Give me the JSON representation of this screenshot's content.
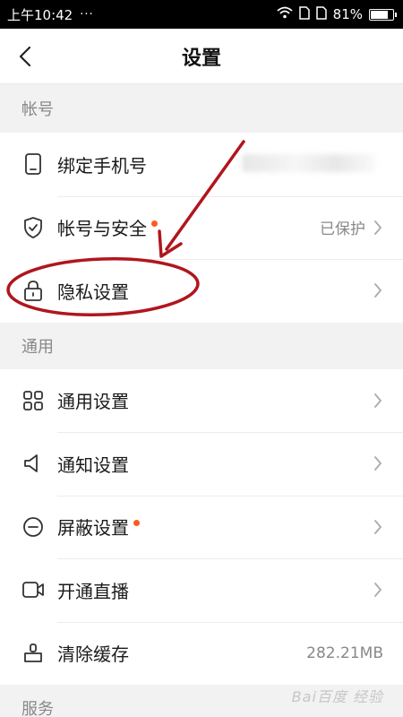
{
  "status_bar": {
    "time": "上午10:42",
    "dots": "···",
    "battery": "81%",
    "battery_level": 0.81
  },
  "header": {
    "title": "设置"
  },
  "sections": {
    "account": {
      "title": "帐号",
      "items": [
        {
          "label": "绑定手机号",
          "value": "",
          "icon": "phone-icon"
        },
        {
          "label": "帐号与安全",
          "value": "已保护",
          "icon": "shield-icon",
          "dot": true
        },
        {
          "label": "隐私设置",
          "value": "",
          "icon": "lock-icon"
        }
      ]
    },
    "general": {
      "title": "通用",
      "items": [
        {
          "label": "通用设置",
          "value": "",
          "icon": "grid-icon"
        },
        {
          "label": "通知设置",
          "value": "",
          "icon": "speaker-icon"
        },
        {
          "label": "屏蔽设置",
          "value": "",
          "icon": "block-icon",
          "dot": true
        },
        {
          "label": "开通直播",
          "value": "",
          "icon": "video-icon"
        },
        {
          "label": "清除缓存",
          "value": "282.21MB",
          "icon": "broom-icon"
        }
      ]
    },
    "service": {
      "title": "服务"
    }
  },
  "watermark": "Bai百度 经验",
  "colors": {
    "annotation": "#b0161d",
    "dot": "#ff5a1f",
    "section_bg": "#f2f2f2"
  }
}
